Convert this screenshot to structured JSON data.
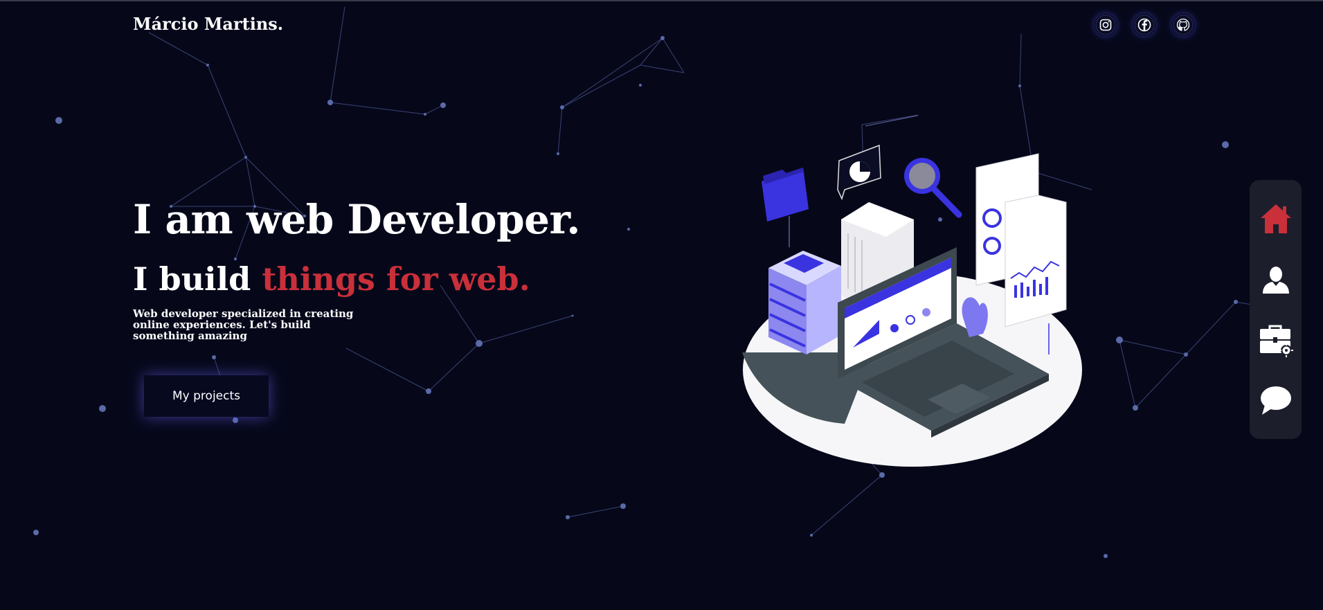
{
  "brand": {
    "name": "Márcio Martins."
  },
  "socials": [
    {
      "icon": "instagram-icon"
    },
    {
      "icon": "facebook-icon"
    },
    {
      "icon": "github-icon"
    }
  ],
  "hero": {
    "title": "I am web Developer.",
    "subtitle_prefix": "I build ",
    "subtitle_accent": "things for web.",
    "description": "Web developer specialized in creating online experiences. Let's build something amazing",
    "cta_label": "My projects"
  },
  "side_nav": [
    {
      "icon": "home-icon",
      "active": true
    },
    {
      "icon": "user-icon",
      "active": false
    },
    {
      "icon": "briefcase-icon",
      "active": false
    },
    {
      "icon": "chat-icon",
      "active": false
    }
  ],
  "colors": {
    "background": "#06081a",
    "accent": "#c9303a",
    "particle": "#5a6aa8",
    "nav_bg": "#1c1e2b",
    "illustration_blue": "#3a33e0"
  }
}
